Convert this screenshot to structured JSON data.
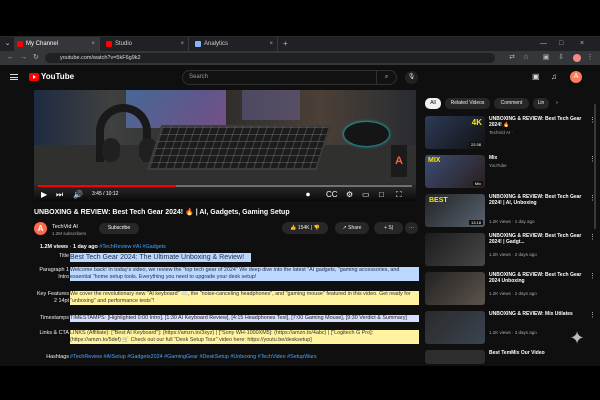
{
  "browser": {
    "tabs": [
      {
        "label": "My Channel",
        "close": "×"
      },
      {
        "label": "Studio",
        "close": "×"
      },
      {
        "label": "Analytics",
        "close": "×"
      }
    ],
    "new_tab": "+",
    "window_controls": [
      "—",
      "□",
      "×"
    ],
    "url": "youtube.com/watch?v=5kF6g9k2"
  },
  "youtube": {
    "brand": "YouTube",
    "search_placeholder": "Search",
    "profile_initial": "A"
  },
  "player": {
    "current_time": "3:45",
    "duration": "10:12",
    "progress_fraction": 0.37,
    "overlay_logo": "A"
  },
  "video": {
    "title": "UNBOXING & REVIEW: Best Tech Gear 2024! 🔥 | AI, Gadgets, Gaming Setup",
    "channel": "TechVid AI",
    "channel_initial": "A",
    "subscribers": "1.2M subscribers",
    "subscribe": "Subscribe",
    "likes": "154K",
    "share": "Share",
    "save": "Sḽ",
    "more": "···"
  },
  "description": {
    "views": "1.2M views",
    "age": "1 day ago",
    "tags": "#TechReview #AI #Gadgets",
    "sections": [
      {
        "label": "Title",
        "text": "Best Tech Gear 2024: The Ultimate Unboxing & Review!"
      },
      {
        "label": "Paragraph 1 Intro",
        "text": "Welcome back! In today's video, we review the \"top tech gear of 2024\" We deep dive into the latest \"AI gadgets, \"gaming accessories, and essential \"home setup tools. Everything you need to upgrade your desk setup!"
      },
      {
        "label": "Key Features 2 14pt",
        "text": "We cover the revolutionary new \"AI keyboard\" ⌨️, the \"noise-canceling headphones\", and \"gaming mouse\" featured in this video. Get ready for \"unboxing\" and performance tests\"!"
      },
      {
        "label": "Timestamps",
        "text": "TIMESTAMPS: [Highlighted 0:00 Intro], [1:30 AI Keyboard Review], [4:15 Headphones Test], [7:00 Gaming Mouse], [9:30 Verdict & Summary]"
      },
      {
        "label": "Links & CTA",
        "text": "LINKS (Affiliate): [\"Best AI Keyboard\"]: (https://amzn.to/3xyz) | [\"Sony WH-1000XM5]: (https://amzn.to/4abc) | [\"Logitech G Pro]: (https://amzn.to/5def) 🛒 Check out our full \"Desk Setup Tour\" video here: https://youtu.be/desksetup]"
      },
      {
        "label": "Hashtags",
        "text": "#TechReview #AISetup #Gadgets2024 #GamingGear #DeskSetup #Unboxing #TechVideo #SetupWars"
      }
    ]
  },
  "sidebar": {
    "chips": [
      "All",
      "Related Videos",
      "Comment",
      "Lin"
    ],
    "recommendations": [
      {
        "title": "UNBOXING & REVIEW: Best Tech Gear 2024! 🔥",
        "meta": "TechVid AI · ",
        "badge": "4K",
        "duration": "22:38"
      },
      {
        "title": "Mix",
        "meta": "YouTube",
        "badge": "MIX",
        "duration": "Mix"
      },
      {
        "title": "UNBOXING & REVIEW: Best Tech Gear 2024! | AI, Unboxing",
        "meta": "1.2K views · 1 day ago",
        "badge": "BEST",
        "duration": "13:18"
      },
      {
        "title": "UNBOXING & REVIEW: Best Tech Gear 2024! | Gadgt...",
        "meta": "1.2K views · 2 days ago",
        "badge": "",
        "duration": ""
      },
      {
        "title": "UNBOXING & REVIEW: Best Tech Gear 2024 Unboxing",
        "meta": "1.2K views · 2 days ago",
        "badge": "",
        "duration": ""
      },
      {
        "title": "UNBOXING & REVIEW: Mix Utilates",
        "meta": "1.2K views · 3 days ago",
        "badge": "",
        "duration": ""
      },
      {
        "title": "Best TemMix Our Video",
        "meta": "",
        "badge": "",
        "duration": ""
      }
    ]
  },
  "colors": {
    "youtube_red": "#ff0000",
    "highlight_blue": "#bdd8ff",
    "highlight_yellow": "#fff3a0",
    "link_blue": "#3ea6ff"
  }
}
